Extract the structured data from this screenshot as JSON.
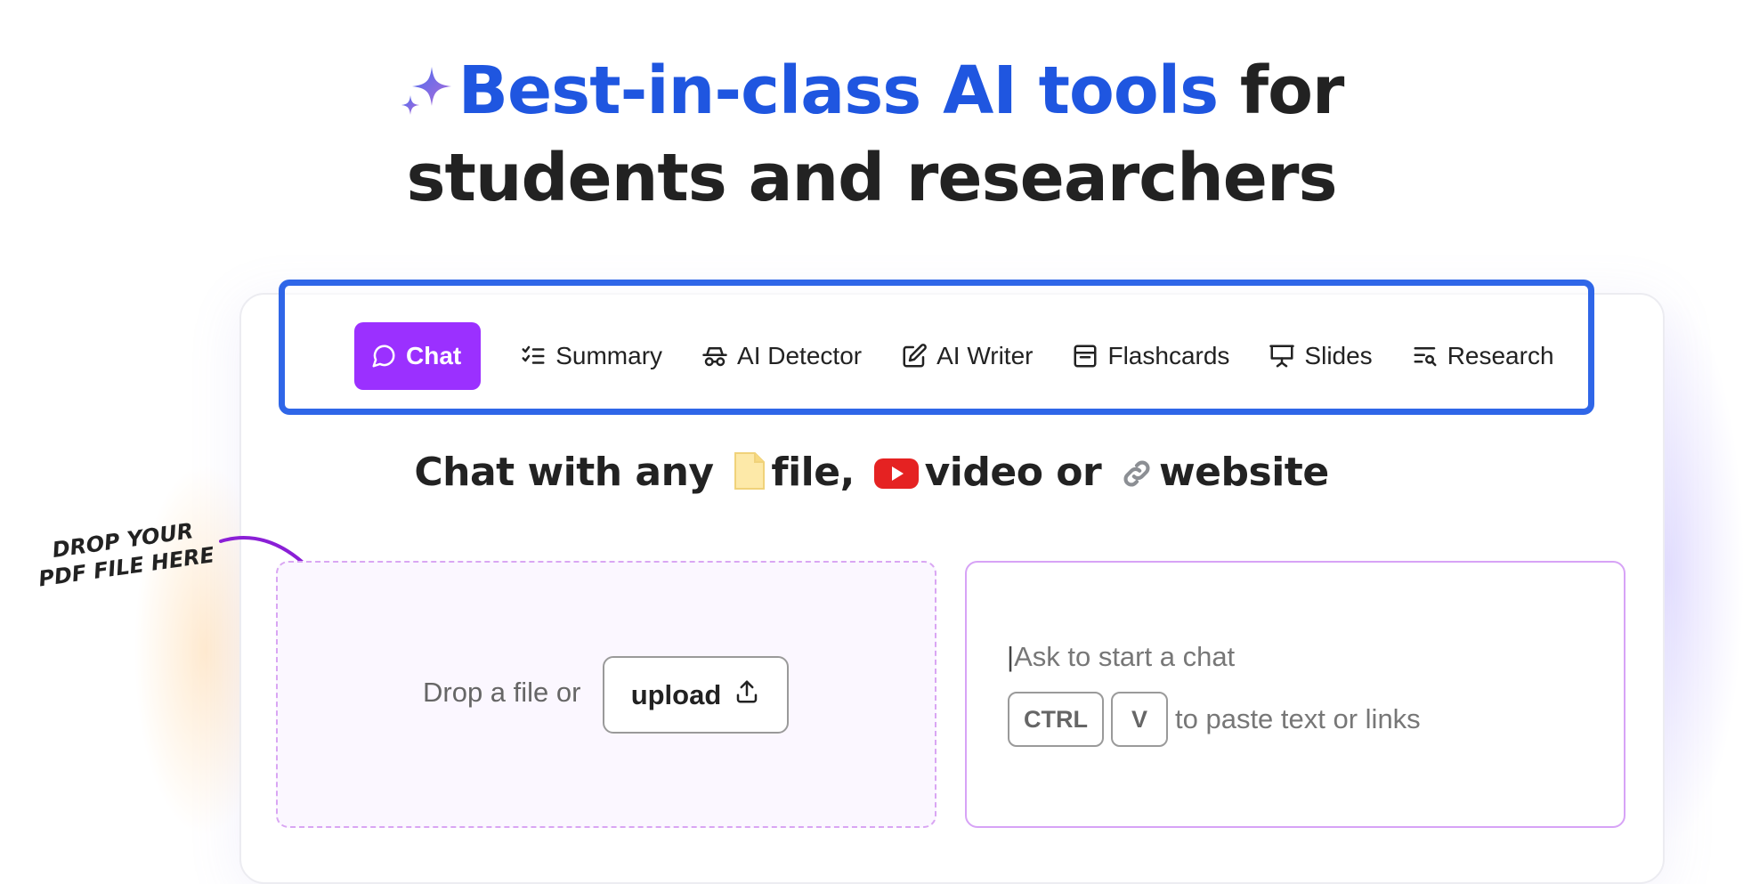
{
  "hero": {
    "sparkle_icon": "sparkle-icon",
    "title_accent": "Best-in-class AI tools",
    "title_rest": " for",
    "title_line2": "students and researchers",
    "accent_color": "#1f56e0"
  },
  "tabs": [
    {
      "label": "Chat",
      "icon": "chat-bubble-icon",
      "active": true
    },
    {
      "label": "Summary",
      "icon": "checklist-icon",
      "active": false
    },
    {
      "label": "AI Detector",
      "icon": "spy-glasses-icon",
      "active": false
    },
    {
      "label": "AI Writer",
      "icon": "edit-icon",
      "active": false
    },
    {
      "label": "Flashcards",
      "icon": "flashcards-icon",
      "active": false
    },
    {
      "label": "Slides",
      "icon": "presentation-icon",
      "active": false
    },
    {
      "label": "Research",
      "icon": "research-list-icon",
      "active": false
    }
  ],
  "subhead": {
    "part1": "Chat with any",
    "part2": "file,",
    "part3": "video or",
    "part4": "website",
    "icons": [
      "file-icon",
      "youtube-icon",
      "link-icon"
    ]
  },
  "hand_note": {
    "line1": "DROP YOUR",
    "line2": "PDF FILE HERE"
  },
  "dropzone": {
    "text": "Drop a file or",
    "upload_label": "upload",
    "upload_icon": "upload-icon"
  },
  "chatbox": {
    "placeholder": "Ask to start a chat",
    "key1": "CTRL",
    "key2": "V",
    "hint": "to paste text or links"
  },
  "colors": {
    "active_tab": "#9b30ff",
    "highlight_frame": "#2f66e8",
    "drop_border": "#d9a6f3"
  }
}
